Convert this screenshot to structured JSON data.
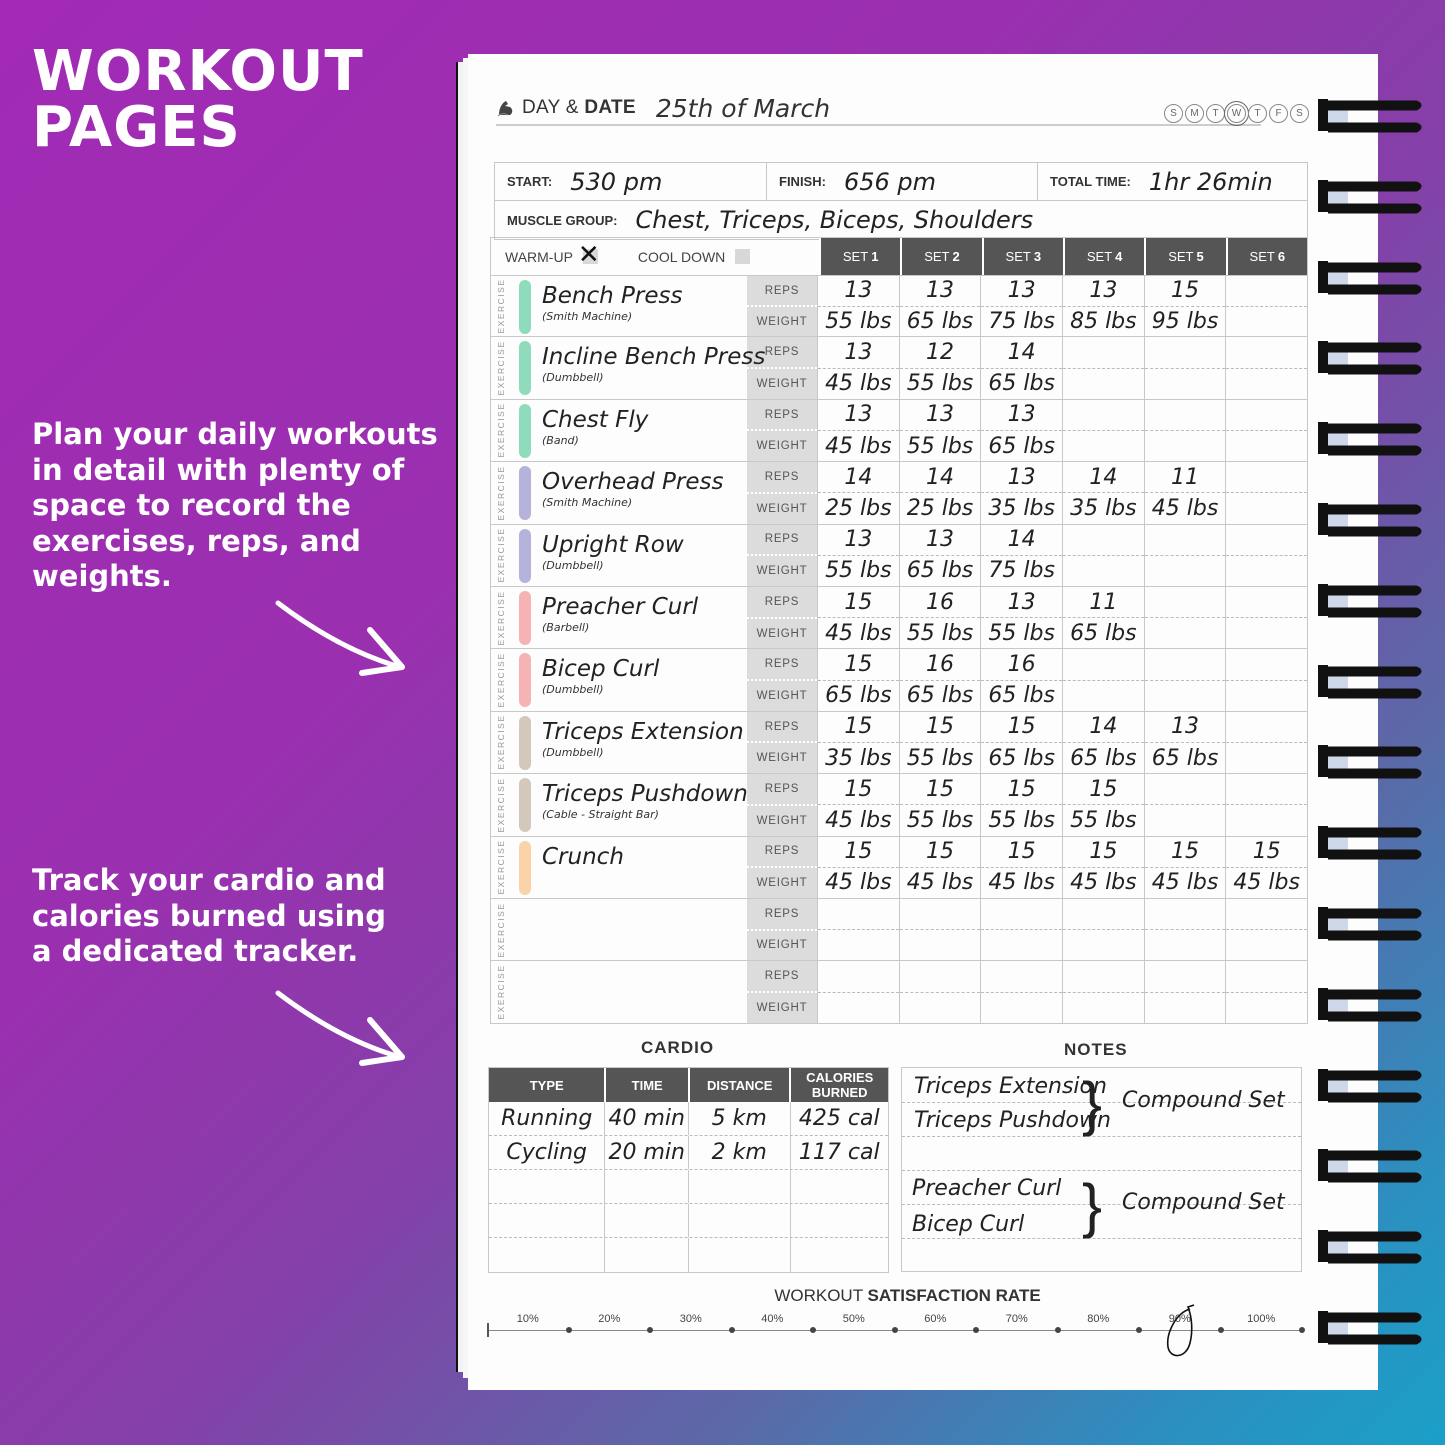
{
  "promo": {
    "headline_line1": "WORKOUT",
    "headline_line2": "PAGES",
    "blurb1": "Plan your daily workouts in detail with plenty of space to record the exercises, reps, and weights.",
    "blurb2": "Track your cardio and calories burned using a dedicated tracker."
  },
  "header": {
    "logo_icon": "muscle-arm-icon",
    "day_label": "DAY &",
    "date_label": "DATE",
    "date_value": "25th of March",
    "days": [
      "S",
      "M",
      "T",
      "W",
      "T",
      "F",
      "S"
    ],
    "selected_day_index": 3
  },
  "session": {
    "start_label": "START:",
    "start_value": "530 pm",
    "finish_label": "FINISH:",
    "finish_value": "656 pm",
    "total_label": "TOTAL TIME:",
    "total_value": "1hr 26min",
    "muscle_label": "MUSCLE GROUP:",
    "muscle_value": "Chest, Triceps, Biceps, Shoulders"
  },
  "exercise_table": {
    "warmup_label": "WARM-UP",
    "warmup_checked": true,
    "cooldown_label": "COOL DOWN",
    "cooldown_checked": false,
    "set_prefix": "SET",
    "sets": [
      "1",
      "2",
      "3",
      "4",
      "5",
      "6"
    ],
    "side_label": "EXERCISE",
    "reps_label": "REPS",
    "weight_label": "WEIGHT",
    "rows": [
      {
        "name": "Bench Press",
        "equipment": "(Smith Machine)",
        "color": "#8fdcbd",
        "reps": [
          "13",
          "13",
          "13",
          "13",
          "15",
          ""
        ],
        "weight": [
          "55 lbs",
          "65 lbs",
          "75 lbs",
          "85 lbs",
          "95 lbs",
          ""
        ]
      },
      {
        "name": "Incline Bench Press",
        "equipment": "(Dumbbell)",
        "color": "#8fdcbd",
        "reps": [
          "13",
          "12",
          "14",
          "",
          "",
          ""
        ],
        "weight": [
          "45 lbs",
          "55 lbs",
          "65 lbs",
          "",
          "",
          ""
        ]
      },
      {
        "name": "Chest Fly",
        "equipment": "(Band)",
        "color": "#8fdcbd",
        "reps": [
          "13",
          "13",
          "13",
          "",
          "",
          ""
        ],
        "weight": [
          "45 lbs",
          "55 lbs",
          "65 lbs",
          "",
          "",
          ""
        ]
      },
      {
        "name": "Overhead Press",
        "equipment": "(Smith Machine)",
        "color": "#b5b3dc",
        "reps": [
          "14",
          "14",
          "13",
          "14",
          "11",
          ""
        ],
        "weight": [
          "25 lbs",
          "25 lbs",
          "35 lbs",
          "35 lbs",
          "45 lbs",
          ""
        ]
      },
      {
        "name": "Upright Row",
        "equipment": "(Dumbbell)",
        "color": "#b5b3dc",
        "reps": [
          "13",
          "13",
          "14",
          "",
          "",
          ""
        ],
        "weight": [
          "55 lbs",
          "65 lbs",
          "75 lbs",
          "",
          "",
          ""
        ]
      },
      {
        "name": "Preacher Curl",
        "equipment": "(Barbell)",
        "color": "#f6b3b3",
        "reps": [
          "15",
          "16",
          "13",
          "11",
          "",
          ""
        ],
        "weight": [
          "45 lbs",
          "55 lbs",
          "55 lbs",
          "65 lbs",
          "",
          ""
        ]
      },
      {
        "name": "Bicep Curl",
        "equipment": "(Dumbbell)",
        "color": "#f6b3b3",
        "reps": [
          "15",
          "16",
          "16",
          "",
          "",
          ""
        ],
        "weight": [
          "65 lbs",
          "65 lbs",
          "65 lbs",
          "",
          "",
          ""
        ]
      },
      {
        "name": "Triceps Extension",
        "equipment": "(Dumbbell)",
        "color": "#d4c7bc",
        "reps": [
          "15",
          "15",
          "15",
          "14",
          "13",
          ""
        ],
        "weight": [
          "35 lbs",
          "55 lbs",
          "65 lbs",
          "65 lbs",
          "65 lbs",
          ""
        ]
      },
      {
        "name": "Triceps Pushdown",
        "equipment": "(Cable - Straight Bar)",
        "color": "#d4c7bc",
        "reps": [
          "15",
          "15",
          "15",
          "15",
          "",
          ""
        ],
        "weight": [
          "45 lbs",
          "55 lbs",
          "55 lbs",
          "55 lbs",
          "",
          ""
        ]
      },
      {
        "name": "Crunch",
        "equipment": "",
        "color": "#fbd3a8",
        "reps": [
          "15",
          "15",
          "15",
          "15",
          "15",
          "15"
        ],
        "weight": [
          "45 lbs",
          "45 lbs",
          "45 lbs",
          "45 lbs",
          "45 lbs",
          "45 lbs"
        ]
      },
      {
        "name": "",
        "equipment": "",
        "color": "",
        "reps": [
          "",
          "",
          "",
          "",
          "",
          ""
        ],
        "weight": [
          "",
          "",
          "",
          "",
          "",
          ""
        ]
      },
      {
        "name": "",
        "equipment": "",
        "color": "",
        "reps": [
          "",
          "",
          "",
          "",
          "",
          ""
        ],
        "weight": [
          "",
          "",
          "",
          "",
          "",
          ""
        ]
      }
    ]
  },
  "cardio": {
    "title": "CARDIO",
    "headers": [
      "TYPE",
      "TIME",
      "DISTANCE",
      "CALORIES BURNED"
    ],
    "rows": [
      [
        "Running",
        "40 min",
        "5 km",
        "425 cal"
      ],
      [
        "Cycling",
        "20 min",
        "2 km",
        "117 cal"
      ],
      [
        "",
        "",
        "",
        ""
      ],
      [
        "",
        "",
        "",
        ""
      ],
      [
        "",
        "",
        "",
        ""
      ]
    ]
  },
  "notes": {
    "title": "NOTES",
    "groups": [
      {
        "items": [
          "Triceps Extension",
          "Triceps Pushdown"
        ],
        "label": "Compound Set"
      },
      {
        "items": [
          "Preacher Curl",
          "Bicep Curl"
        ],
        "label": "Compound Set"
      }
    ]
  },
  "satisfaction": {
    "title_light": "WORKOUT",
    "title_bold": "SATISFACTION RATE",
    "ticks": [
      "10%",
      "20%",
      "30%",
      "40%",
      "50%",
      "60%",
      "70%",
      "80%",
      "90%",
      "100%"
    ],
    "selected_value_percent": 85
  }
}
